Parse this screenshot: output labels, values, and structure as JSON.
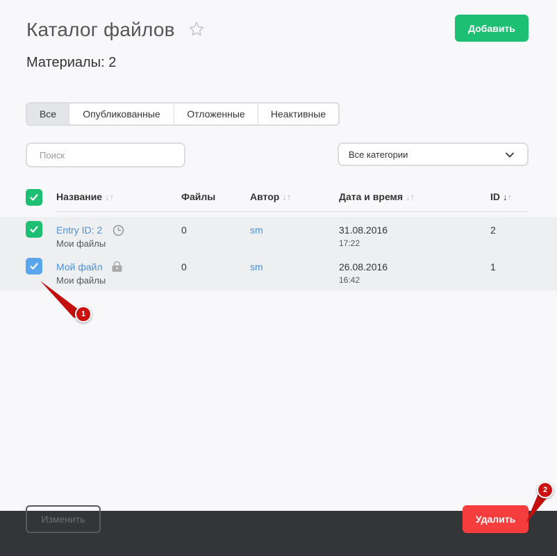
{
  "header": {
    "title": "Каталог файлов",
    "subtitle": "Материалы: 2",
    "add_label": "Добавить"
  },
  "tabs": [
    {
      "label": "Все",
      "active": true
    },
    {
      "label": "Опубликованные",
      "active": false
    },
    {
      "label": "Отложенные",
      "active": false
    },
    {
      "label": "Неактивные",
      "active": false
    }
  ],
  "filters": {
    "search_placeholder": "Поиск",
    "category_selected": "Все категории"
  },
  "table": {
    "columns": {
      "name": "Название",
      "files": "Файлы",
      "author": "Автор",
      "datetime": "Дата и время",
      "id": "ID"
    },
    "rows": [
      {
        "name": "Entry ID: 2",
        "category": "Мои файлы",
        "status_icon": "clock-icon",
        "files": "0",
        "author": "sm",
        "date": "31.08.2016",
        "time": "17:22",
        "id": "2",
        "checked": true
      },
      {
        "name": "Мой файл",
        "category": "Мои файлы",
        "status_icon": "lock-icon",
        "files": "0",
        "author": "sm",
        "date": "26.08.2016",
        "time": "16:42",
        "id": "1",
        "checked": true
      }
    ]
  },
  "annotations": {
    "marker_1": "1",
    "marker_2": "2"
  },
  "footer": {
    "edit_label": "Изменить",
    "delete_label": "Удалить"
  },
  "colors": {
    "accent_green": "#1dbf73",
    "checkbox_blue": "#5aa6ec",
    "danger_red": "#f53d3d",
    "link_blue": "#4a90d9",
    "marker_red": "#cc1111"
  }
}
